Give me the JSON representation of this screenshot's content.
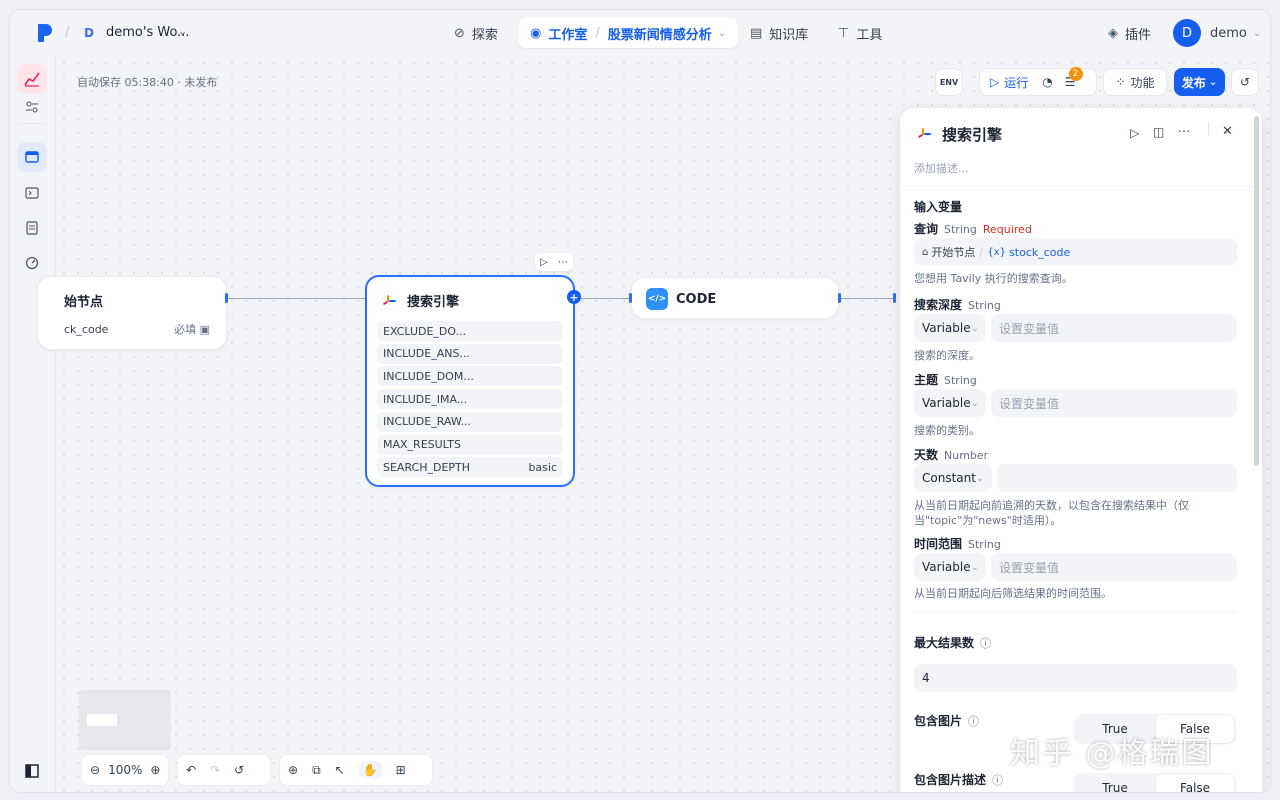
{
  "workspace": {
    "avatar": "D",
    "name": "demo's Wo..."
  },
  "nav": {
    "explore": "探索",
    "studio": "工作室",
    "app_name": "股票新闻情感分析",
    "knowledge": "知识库",
    "tools": "工具",
    "plugins": "插件"
  },
  "user": {
    "avatar": "D",
    "name": "demo"
  },
  "canvas": {
    "autosave": "自动保存 05:38:40 · 未发布",
    "toolbar": {
      "env": "ENV",
      "run": "运行",
      "checklist_badge": "2",
      "features": "功能",
      "publish": "发布"
    }
  },
  "nodes": {
    "start": {
      "title": "始节点",
      "var": "ck_code",
      "required": "必填"
    },
    "search": {
      "title": "搜索引擎",
      "fields": [
        {
          "name": "EXCLUDE_DO...",
          "value": ""
        },
        {
          "name": "INCLUDE_ANS...",
          "value": ""
        },
        {
          "name": "INCLUDE_DOM...",
          "value": ""
        },
        {
          "name": "INCLUDE_IMA...",
          "value": ""
        },
        {
          "name": "INCLUDE_RAW...",
          "value": ""
        },
        {
          "name": "MAX_RESULTS",
          "value": ""
        },
        {
          "name": "SEARCH_DEPTH",
          "value": "basic"
        }
      ]
    },
    "code": {
      "title": "CODE"
    }
  },
  "bottom": {
    "zoom": "100%"
  },
  "panel": {
    "title": "搜索引擎",
    "desc_placeholder": "添加描述...",
    "inputs_title": "输入变量",
    "query": {
      "label": "查询",
      "type": "String",
      "required": "Required",
      "source": "开始节点",
      "var": "stock_code",
      "hint": "您想用 Tavily 执行的搜索查询。"
    },
    "depth": {
      "label": "搜索深度",
      "type": "String",
      "mode": "Variable",
      "placeholder": "设置变量值",
      "hint": "搜索的深度。"
    },
    "topic": {
      "label": "主题",
      "type": "String",
      "mode": "Variable",
      "placeholder": "设置变量值",
      "hint": "搜索的类别。"
    },
    "days": {
      "label": "天数",
      "type": "Number",
      "mode": "Constant",
      "value": "",
      "hint": "从当前日期起向前追溯的天数，以包含在搜索结果中（仅当\"topic\"为\"news\"时适用）。"
    },
    "time_range": {
      "label": "时间范围",
      "type": "String",
      "mode": "Variable",
      "placeholder": "设置变量值",
      "hint": "从当前日期起向后筛选结果的时间范围。"
    },
    "max_results": {
      "label": "最大结果数",
      "value": "4"
    },
    "include_images": {
      "label": "包含图片",
      "true": "True",
      "false": "False"
    },
    "include_image_desc": {
      "label": "包含图片描述",
      "true": "True",
      "false": "False"
    }
  },
  "watermark": "知乎 @格瑞图"
}
